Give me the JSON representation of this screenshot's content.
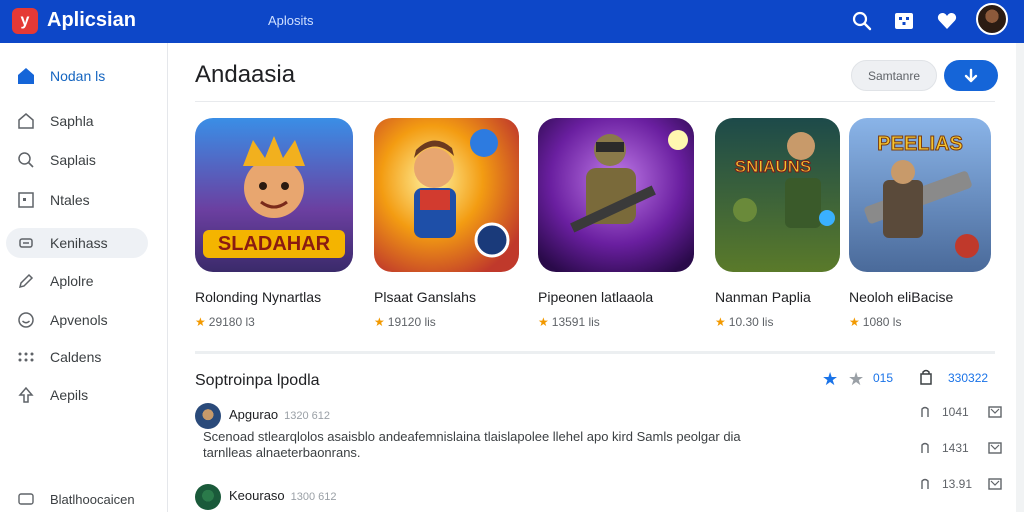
{
  "app": {
    "title": "Aplicsian",
    "logo_glyph": "y",
    "search_hint": "Aplosits",
    "brand_color": "#0d47c8"
  },
  "topbar_icons": [
    "search-icon",
    "grid-icon",
    "heart-icon",
    "user-avatar"
  ],
  "sidebar": {
    "items": [
      {
        "label": "Nodan ls",
        "icon": "home-icon",
        "state": "active"
      },
      {
        "label": "Saphla",
        "icon": "house-outline-icon",
        "state": "normal"
      },
      {
        "label": "Saplais",
        "icon": "search-icon",
        "state": "normal"
      },
      {
        "label": "Ntales",
        "icon": "square-dot-icon",
        "state": "normal"
      },
      {
        "label": "Kenihass",
        "icon": "chip-icon",
        "state": "selected"
      },
      {
        "label": "Aplolre",
        "icon": "pencil-icon",
        "state": "normal"
      },
      {
        "label": "Apvenols",
        "icon": "smile-icon",
        "state": "normal"
      },
      {
        "label": "Caldens",
        "icon": "apps-icon",
        "state": "normal"
      },
      {
        "label": "Aepils",
        "icon": "upload-icon",
        "state": "normal"
      }
    ],
    "footer_label": "Blatlhoocaicen"
  },
  "main": {
    "title": "Andaasia",
    "sort_label": "Samtanre",
    "download_icon": "arrow-down-icon"
  },
  "apps": [
    {
      "name": "Rolonding Nynartlas",
      "rating": "29180 l3",
      "art_text": "SLADAHAR"
    },
    {
      "name": "Plsaat Ganslahs",
      "rating": "19120 lis",
      "art_text": ""
    },
    {
      "name": "Pipeonen latlaaola",
      "rating": "13591 lis",
      "art_text": ""
    },
    {
      "name": "Nanman Paplia",
      "rating": "10.30 lis",
      "art_text": "SNIAUNS"
    },
    {
      "name": "Neoloh eliBacise",
      "rating": "1080 ls",
      "art_text": "PEELIAS"
    }
  ],
  "reviews_section": {
    "title": "Soptroinpa lpodla",
    "count": "015",
    "total": "330322"
  },
  "reviews": [
    {
      "author": "Apgurao",
      "meta": "1320  612",
      "body": "Scenoad stlearqlolos asaisblo andeafemnislaina tlaislapolee llehel apo kird Samls peolgar dia tarnlleas alnaeterbaonrans.",
      "likes": "1041"
    },
    {
      "author": "",
      "meta": "",
      "body": "",
      "likes": "1431"
    },
    {
      "author": "Keouraso",
      "meta": "1300  612",
      "body": "",
      "likes": "13.91"
    }
  ]
}
